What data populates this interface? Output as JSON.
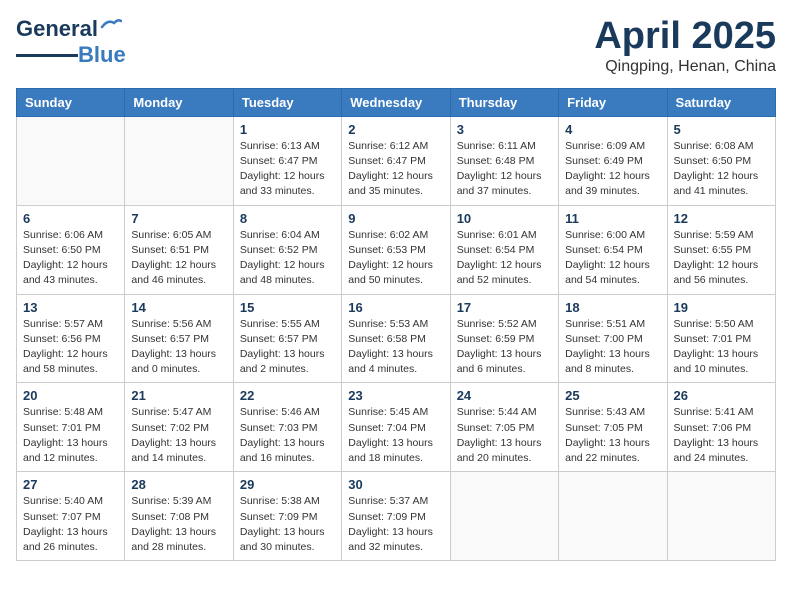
{
  "header": {
    "logo_line1": "General",
    "logo_line2": "Blue",
    "month": "April 2025",
    "location": "Qingping, Henan, China"
  },
  "weekdays": [
    "Sunday",
    "Monday",
    "Tuesday",
    "Wednesday",
    "Thursday",
    "Friday",
    "Saturday"
  ],
  "weeks": [
    [
      {
        "day": "",
        "info": ""
      },
      {
        "day": "",
        "info": ""
      },
      {
        "day": "1",
        "info": "Sunrise: 6:13 AM\nSunset: 6:47 PM\nDaylight: 12 hours\nand 33 minutes."
      },
      {
        "day": "2",
        "info": "Sunrise: 6:12 AM\nSunset: 6:47 PM\nDaylight: 12 hours\nand 35 minutes."
      },
      {
        "day": "3",
        "info": "Sunrise: 6:11 AM\nSunset: 6:48 PM\nDaylight: 12 hours\nand 37 minutes."
      },
      {
        "day": "4",
        "info": "Sunrise: 6:09 AM\nSunset: 6:49 PM\nDaylight: 12 hours\nand 39 minutes."
      },
      {
        "day": "5",
        "info": "Sunrise: 6:08 AM\nSunset: 6:50 PM\nDaylight: 12 hours\nand 41 minutes."
      }
    ],
    [
      {
        "day": "6",
        "info": "Sunrise: 6:06 AM\nSunset: 6:50 PM\nDaylight: 12 hours\nand 43 minutes."
      },
      {
        "day": "7",
        "info": "Sunrise: 6:05 AM\nSunset: 6:51 PM\nDaylight: 12 hours\nand 46 minutes."
      },
      {
        "day": "8",
        "info": "Sunrise: 6:04 AM\nSunset: 6:52 PM\nDaylight: 12 hours\nand 48 minutes."
      },
      {
        "day": "9",
        "info": "Sunrise: 6:02 AM\nSunset: 6:53 PM\nDaylight: 12 hours\nand 50 minutes."
      },
      {
        "day": "10",
        "info": "Sunrise: 6:01 AM\nSunset: 6:54 PM\nDaylight: 12 hours\nand 52 minutes."
      },
      {
        "day": "11",
        "info": "Sunrise: 6:00 AM\nSunset: 6:54 PM\nDaylight: 12 hours\nand 54 minutes."
      },
      {
        "day": "12",
        "info": "Sunrise: 5:59 AM\nSunset: 6:55 PM\nDaylight: 12 hours\nand 56 minutes."
      }
    ],
    [
      {
        "day": "13",
        "info": "Sunrise: 5:57 AM\nSunset: 6:56 PM\nDaylight: 12 hours\nand 58 minutes."
      },
      {
        "day": "14",
        "info": "Sunrise: 5:56 AM\nSunset: 6:57 PM\nDaylight: 13 hours\nand 0 minutes."
      },
      {
        "day": "15",
        "info": "Sunrise: 5:55 AM\nSunset: 6:57 PM\nDaylight: 13 hours\nand 2 minutes."
      },
      {
        "day": "16",
        "info": "Sunrise: 5:53 AM\nSunset: 6:58 PM\nDaylight: 13 hours\nand 4 minutes."
      },
      {
        "day": "17",
        "info": "Sunrise: 5:52 AM\nSunset: 6:59 PM\nDaylight: 13 hours\nand 6 minutes."
      },
      {
        "day": "18",
        "info": "Sunrise: 5:51 AM\nSunset: 7:00 PM\nDaylight: 13 hours\nand 8 minutes."
      },
      {
        "day": "19",
        "info": "Sunrise: 5:50 AM\nSunset: 7:01 PM\nDaylight: 13 hours\nand 10 minutes."
      }
    ],
    [
      {
        "day": "20",
        "info": "Sunrise: 5:48 AM\nSunset: 7:01 PM\nDaylight: 13 hours\nand 12 minutes."
      },
      {
        "day": "21",
        "info": "Sunrise: 5:47 AM\nSunset: 7:02 PM\nDaylight: 13 hours\nand 14 minutes."
      },
      {
        "day": "22",
        "info": "Sunrise: 5:46 AM\nSunset: 7:03 PM\nDaylight: 13 hours\nand 16 minutes."
      },
      {
        "day": "23",
        "info": "Sunrise: 5:45 AM\nSunset: 7:04 PM\nDaylight: 13 hours\nand 18 minutes."
      },
      {
        "day": "24",
        "info": "Sunrise: 5:44 AM\nSunset: 7:05 PM\nDaylight: 13 hours\nand 20 minutes."
      },
      {
        "day": "25",
        "info": "Sunrise: 5:43 AM\nSunset: 7:05 PM\nDaylight: 13 hours\nand 22 minutes."
      },
      {
        "day": "26",
        "info": "Sunrise: 5:41 AM\nSunset: 7:06 PM\nDaylight: 13 hours\nand 24 minutes."
      }
    ],
    [
      {
        "day": "27",
        "info": "Sunrise: 5:40 AM\nSunset: 7:07 PM\nDaylight: 13 hours\nand 26 minutes."
      },
      {
        "day": "28",
        "info": "Sunrise: 5:39 AM\nSunset: 7:08 PM\nDaylight: 13 hours\nand 28 minutes."
      },
      {
        "day": "29",
        "info": "Sunrise: 5:38 AM\nSunset: 7:09 PM\nDaylight: 13 hours\nand 30 minutes."
      },
      {
        "day": "30",
        "info": "Sunrise: 5:37 AM\nSunset: 7:09 PM\nDaylight: 13 hours\nand 32 minutes."
      },
      {
        "day": "",
        "info": ""
      },
      {
        "day": "",
        "info": ""
      },
      {
        "day": "",
        "info": ""
      }
    ]
  ]
}
